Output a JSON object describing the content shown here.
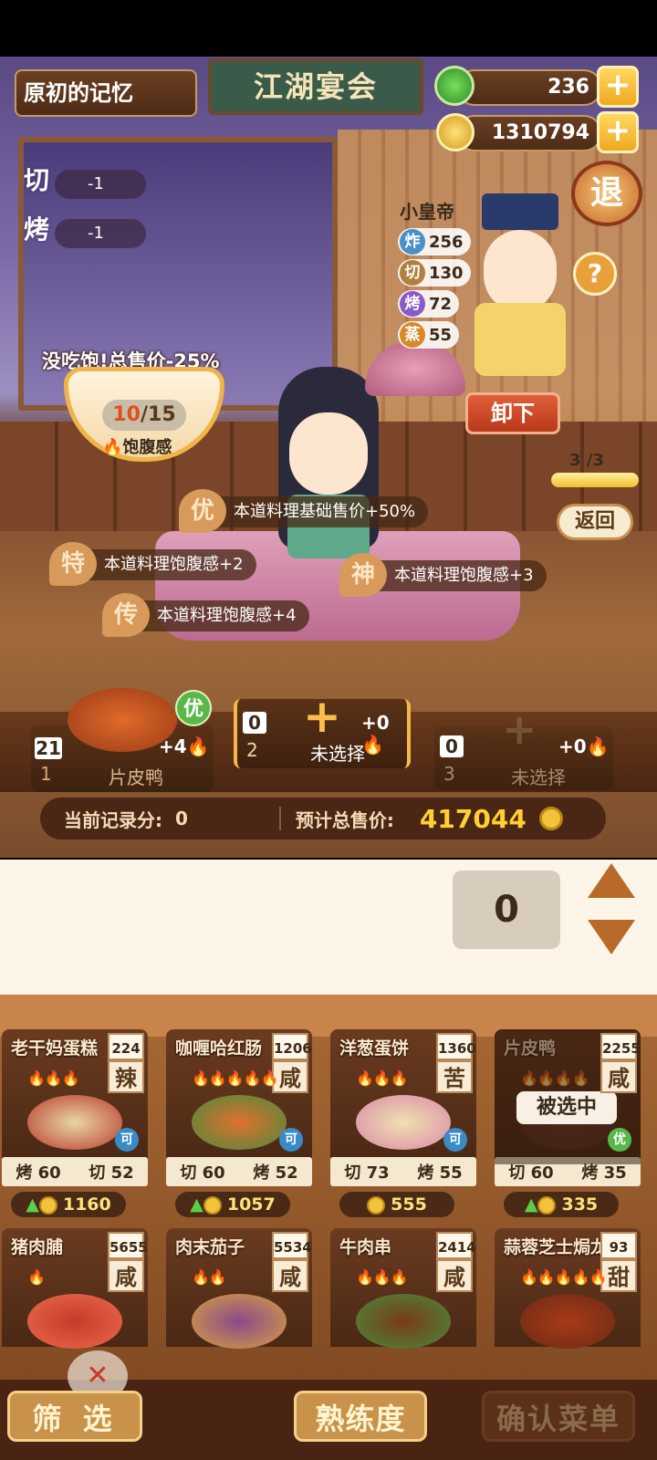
{
  "header": {
    "level_title": "原初的记忆",
    "banner_title": "江湖宴会",
    "jade": "236",
    "coins": "1310794",
    "exit_label": "退",
    "help_label": "?"
  },
  "cook_modifiers": [
    {
      "method": "切",
      "value": "-1"
    },
    {
      "method": "烤",
      "value": "-1"
    }
  ],
  "customer": {
    "name": "小皇帝",
    "stats": [
      {
        "method": "炸",
        "value": "256",
        "color": "#4a90c8"
      },
      {
        "method": "切",
        "value": "130",
        "color": "#b08040"
      },
      {
        "method": "烤",
        "value": "72",
        "color": "#8a5ac8"
      },
      {
        "method": "蒸",
        "value": "55",
        "color": "#d88a2a"
      }
    ]
  },
  "satiety": {
    "warning": "没吃饱!总售价-25%",
    "current": "10",
    "total": "15",
    "label": "饱腹感"
  },
  "unload_label": "卸下",
  "round": {
    "current": "3",
    "total": "3",
    "progress": 1.0,
    "back_label": "返回"
  },
  "effects": [
    {
      "tag": "优",
      "text": "本道料理基础售价+50%"
    },
    {
      "tag": "特",
      "text": "本道料理饱腹感+2"
    },
    {
      "tag": "神",
      "text": "本道料理饱腹感+3"
    },
    {
      "tag": "传",
      "text": "本道料理饱腹感+4"
    }
  ],
  "slots": [
    {
      "index": "1",
      "label": "片皮鸭",
      "count": "21",
      "bonus": "+4",
      "badge": "优"
    },
    {
      "index": "2",
      "label": "未选择",
      "count": "0",
      "bonus": "+0"
    },
    {
      "index": "3",
      "label": "未选择",
      "count": "0",
      "bonus": "+0"
    }
  ],
  "summary": {
    "record_label": "当前记录分:",
    "record_value": "0",
    "total_label": "预计总售价:",
    "total_value": "417044"
  },
  "quantity": "0",
  "menu": [
    {
      "name": "老干妈蛋糕",
      "count": "224",
      "taste": "辣",
      "flames": 3,
      "stat1": "烤",
      "v1": "60",
      "stat2": "切",
      "v2": "52",
      "price": "1160",
      "badge": "可",
      "up": true,
      "colorA": "#e8d6a8",
      "colorB": "#b83a2a"
    },
    {
      "name": "咖喱哈红肠",
      "count": "1206",
      "taste": "咸",
      "flames": 5,
      "stat1": "切",
      "v1": "60",
      "stat2": "烤",
      "v2": "52",
      "price": "1057",
      "badge": "可",
      "up": true,
      "colorA": "#e07030",
      "colorB": "#4a8a3a"
    },
    {
      "name": "洋葱蛋饼",
      "count": "1360",
      "taste": "苦",
      "flames": 3,
      "stat1": "切",
      "v1": "73",
      "stat2": "烤",
      "v2": "55",
      "price": "555",
      "badge": "可",
      "up": false,
      "colorA": "#f0e0b0",
      "colorB": "#d88aa8"
    },
    {
      "name": "片皮鸭",
      "count": "2255",
      "taste": "咸",
      "flames": 4,
      "stat1": "切",
      "v1": "60",
      "stat2": "烤",
      "v2": "35",
      "price": "335",
      "badge": "优",
      "up": true,
      "selected": "被选中",
      "colorA": "#6a3a24",
      "colorB": "#5a3020"
    },
    {
      "name": "猪肉脯",
      "count": "5655",
      "taste": "咸",
      "flames": 1,
      "colorA": "#c83a2a",
      "colorB": "#e86a4a"
    },
    {
      "name": "肉末茄子",
      "count": "5534",
      "taste": "咸",
      "flames": 2,
      "colorA": "#8a4a8a",
      "colorB": "#d8a040"
    },
    {
      "name": "牛肉串",
      "count": "2414",
      "taste": "咸",
      "flames": 3,
      "colorA": "#7a3a1a",
      "colorB": "#4a8a3a"
    },
    {
      "name": "蒜蓉芝士焗龙虾",
      "count": "93",
      "taste": "甜",
      "flames": 5,
      "colorA": "#a83a1a",
      "colorB": "#6a2a14"
    }
  ],
  "bottom": {
    "filter": "筛 选",
    "proficiency": "熟练度",
    "confirm": "确认菜单"
  }
}
